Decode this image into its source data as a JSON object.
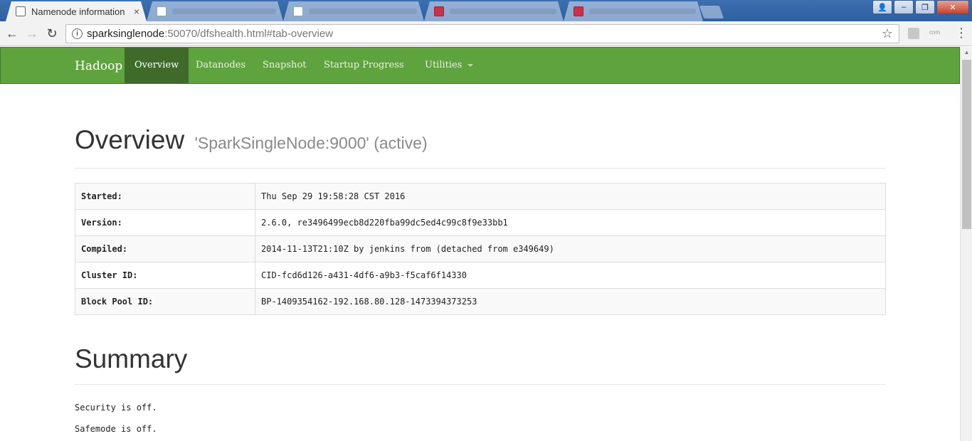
{
  "browser": {
    "active_tab": {
      "title": "Namenode information",
      "close": "×"
    },
    "win_controls": {
      "user": "👤",
      "minimize": "–",
      "maximize": "❐",
      "close": "✕"
    },
    "nav": {
      "back": "←",
      "forward": "→",
      "reload": "↻"
    },
    "url": {
      "host": "sparksinglenode",
      "path": ":50070/dfshealth.html#tab-overview"
    },
    "menu": "⋮",
    "ext2_label": "cnm"
  },
  "navbar": {
    "brand": "Hadoop",
    "items": [
      {
        "label": "Overview",
        "active": true
      },
      {
        "label": "Datanodes",
        "active": false
      },
      {
        "label": "Snapshot",
        "active": false
      },
      {
        "label": "Startup Progress",
        "active": false
      },
      {
        "label": "Utilities",
        "active": false
      }
    ]
  },
  "overview": {
    "title": "Overview",
    "subtitle": "'SparkSingleNode:9000' (active)",
    "rows": [
      {
        "key": "Started:",
        "value": "Thu Sep 29 19:58:28 CST 2016"
      },
      {
        "key": "Version:",
        "value": "2.6.0, re3496499ecb8d220fba99dc5ed4c99c8f9e33bb1"
      },
      {
        "key": "Compiled:",
        "value": "2014-11-13T21:10Z by jenkins from (detached from e349649)"
      },
      {
        "key": "Cluster ID:",
        "value": "CID-fcd6d126-a431-4df6-a9b3-f5caf6f14330"
      },
      {
        "key": "Block Pool ID:",
        "value": "BP-1409354162-192.168.80.128-1473394373253"
      }
    ]
  },
  "summary": {
    "title": "Summary",
    "security": "Security is off.",
    "safemode": "Safemode is off."
  }
}
